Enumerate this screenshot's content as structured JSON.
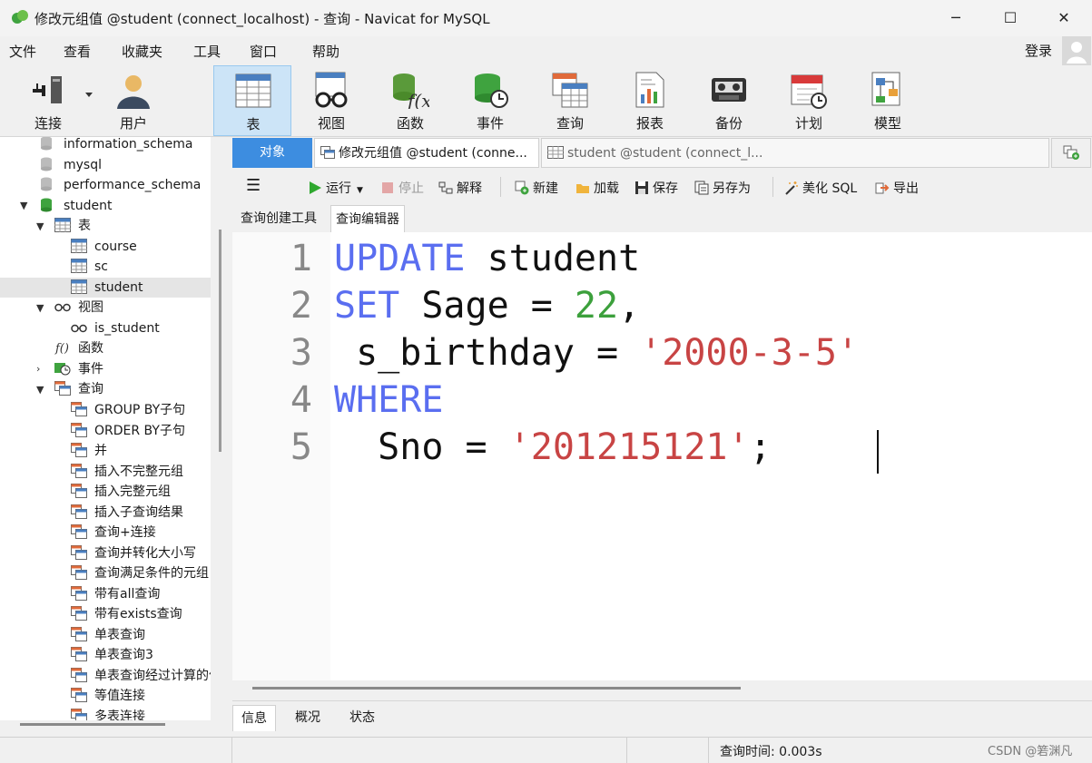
{
  "window": {
    "title": "修改元组值 @student (connect_localhost) - 查询 - Navicat for MySQL",
    "controls": {
      "minimize": "─",
      "maximize": "☐",
      "close": "✕"
    }
  },
  "menubar": {
    "items": [
      "文件",
      "查看",
      "收藏夹",
      "工具",
      "窗口",
      "帮助"
    ],
    "login": "登录"
  },
  "toolbar": {
    "items": [
      {
        "label": "连接",
        "icon": "plug-icon"
      },
      {
        "label": "用户",
        "icon": "user-icon"
      },
      {
        "label": "表",
        "icon": "table-icon"
      },
      {
        "label": "视图",
        "icon": "view-glasses-icon"
      },
      {
        "label": "函数",
        "icon": "function-icon"
      },
      {
        "label": "事件",
        "icon": "event-clock-icon"
      },
      {
        "label": "查询",
        "icon": "query-icon"
      },
      {
        "label": "报表",
        "icon": "report-icon"
      },
      {
        "label": "备份",
        "icon": "backup-tape-icon"
      },
      {
        "label": "计划",
        "icon": "calendar-icon"
      },
      {
        "label": "模型",
        "icon": "model-icon"
      }
    ],
    "active": "表"
  },
  "tree": {
    "databases": [
      "information_schema",
      "mysql",
      "performance_schema",
      "student"
    ],
    "tables_group": "表",
    "tables": [
      "course",
      "sc",
      "student"
    ],
    "selected_table": "student",
    "views_group": "视图",
    "views": [
      "is_student"
    ],
    "functions_group": "函数",
    "events_group": "事件",
    "queries_group": "查询",
    "queries": [
      "GROUP BY子句",
      "ORDER BY子句",
      "并",
      "插入不完整元组",
      "插入完整元组",
      "插入子查询结果",
      "查询+连接",
      "查询并转化大小写",
      "查询满足条件的元组",
      "带有all查询",
      "带有exists查询",
      "单表查询",
      "单表查询3",
      "单表查询经过计算的值",
      "等值连接",
      "多表连接"
    ]
  },
  "tabs": {
    "objects": "对象",
    "modify": "修改元组值 @student (conne...",
    "student": "student @student (connect_l..."
  },
  "query_toolbar": {
    "run": "运行",
    "stop": "停止",
    "explain": "解释",
    "new": "新建",
    "load": "加载",
    "save": "保存",
    "save_as": "另存为",
    "beautify": "美化 SQL",
    "export": "导出"
  },
  "subtabs": {
    "builder": "查询创建工具",
    "editor": "查询编辑器"
  },
  "editor": {
    "line_numbers": [
      "1",
      "2",
      "3",
      "4",
      "5"
    ],
    "lines": [
      [
        {
          "t": "UPDATE",
          "c": "kw"
        },
        {
          "t": " student",
          "c": ""
        }
      ],
      [
        {
          "t": "SET",
          "c": "kw"
        },
        {
          "t": " Sage = ",
          "c": ""
        },
        {
          "t": "22",
          "c": "num"
        },
        {
          "t": ",",
          "c": ""
        }
      ],
      [
        {
          "t": " s_birthday = ",
          "c": ""
        },
        {
          "t": "'2000-3-5'",
          "c": "str"
        }
      ],
      [
        {
          "t": "WHERE",
          "c": "kw"
        }
      ],
      [
        {
          "t": "  Sno = ",
          "c": ""
        },
        {
          "t": "'201215121'",
          "c": "str"
        },
        {
          "t": ";",
          "c": ""
        }
      ]
    ]
  },
  "info_tabs": [
    "信息",
    "概况",
    "状态"
  ],
  "status": {
    "query_time": "查询时间: 0.003s",
    "watermark": "CSDN @箬渊凡"
  },
  "colors": {
    "keyword": "#5a6ef0",
    "number": "#3ca03c",
    "string": "#c84444",
    "active_tab": "#3d8de0"
  }
}
